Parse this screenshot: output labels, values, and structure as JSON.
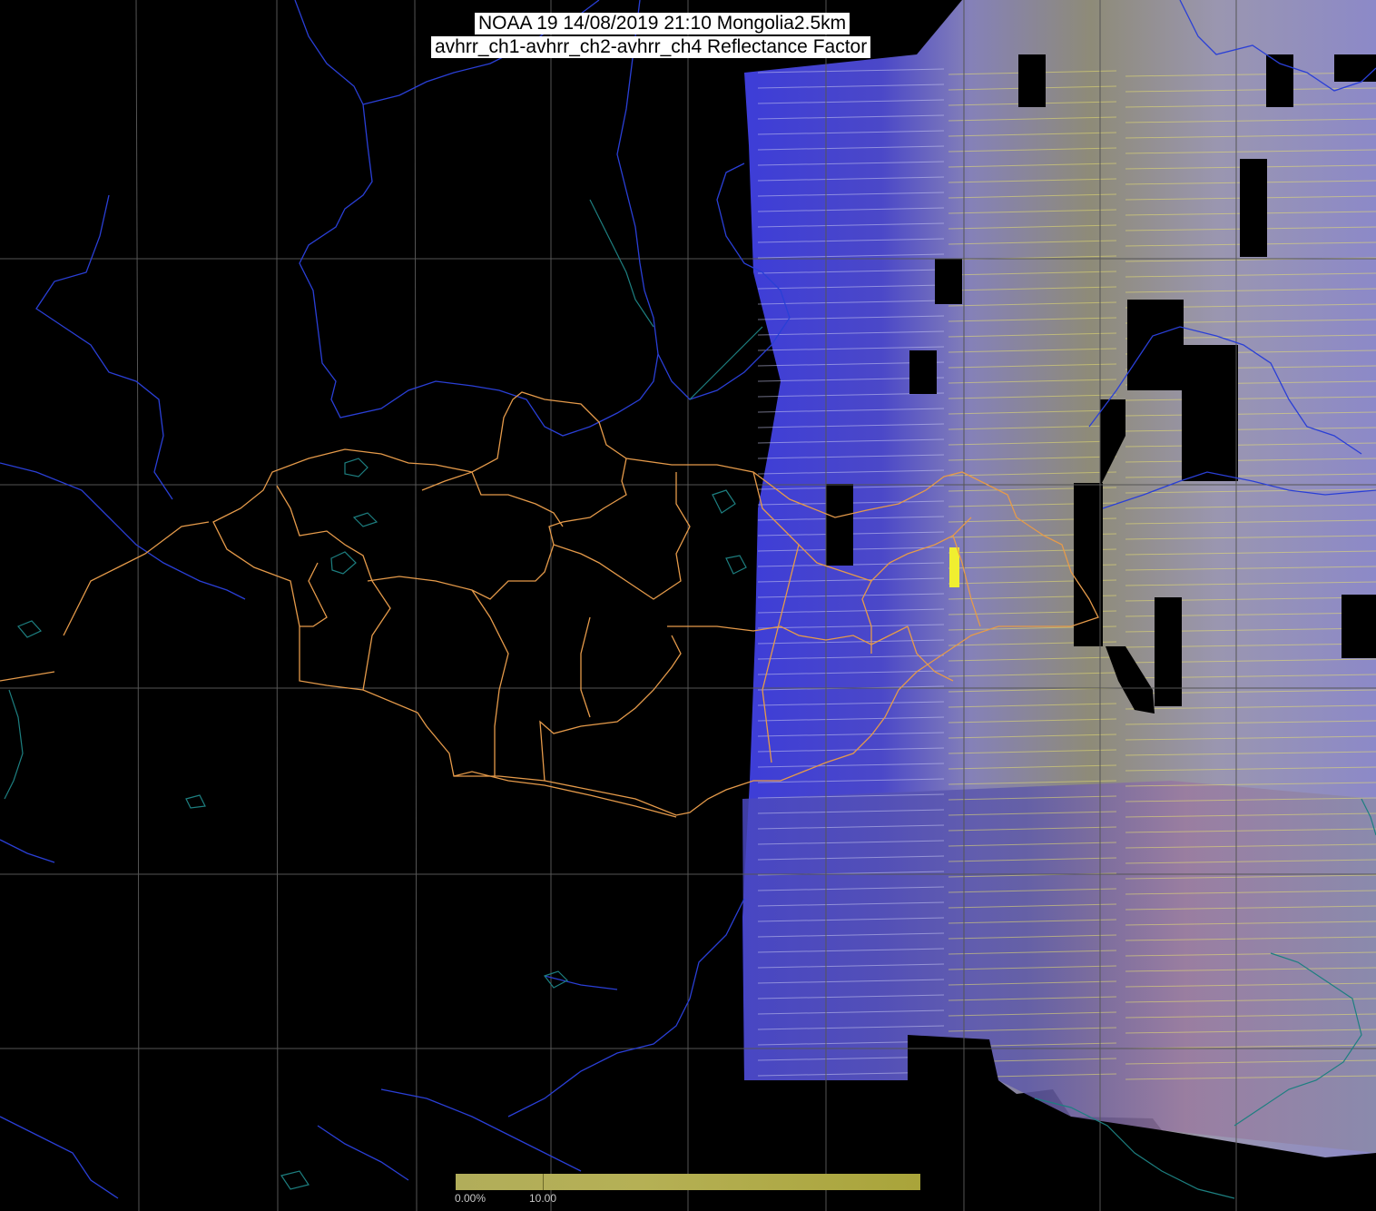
{
  "title": {
    "line1": "NOAA 19 14/08/2019 21:10 Mongolia2.5km",
    "line2": "avhrr_ch1-avhrr_ch2-avhrr_ch4 Reflectance Factor"
  },
  "colorbar": {
    "min_label": "0.00%",
    "max_label": "10.00"
  },
  "colors": {
    "background": "#000000",
    "graticule": "#555555",
    "rivers": "#2a3fd6",
    "coastlines": "#1d7f80",
    "admin_borders": "#e59a4a",
    "swath_blue": "#4a4ad0",
    "swath_lavender": "#8a88c8",
    "swath_olive": "#8c8a6a",
    "scan_lines": "#e8e070"
  }
}
